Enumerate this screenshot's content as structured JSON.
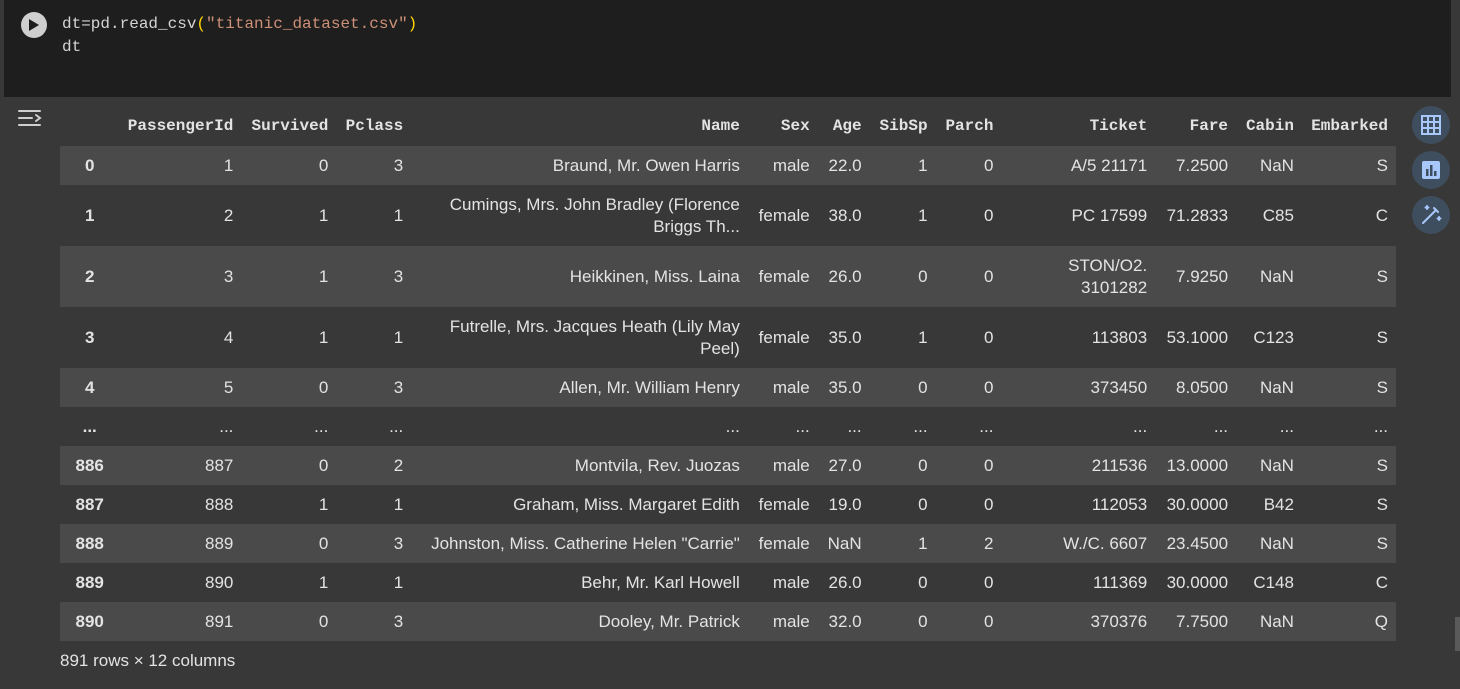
{
  "code_cell": {
    "line1_prefix": "dt=pd.read_csv",
    "line1_open": "(",
    "line1_string": "\"titanic_dataset.csv\"",
    "line1_close": ")",
    "line2": "dt",
    "run_icon": "play-icon"
  },
  "output": {
    "toggle_icon": "output-options-icon",
    "columns": [
      "PassengerId",
      "Survived",
      "Pclass",
      "Name",
      "Sex",
      "Age",
      "SibSp",
      "Parch",
      "Ticket",
      "Fare",
      "Cabin",
      "Embarked"
    ],
    "rows": [
      {
        "index": "0",
        "cells": [
          "1",
          "0",
          "3",
          "Braund, Mr. Owen Harris",
          "male",
          "22.0",
          "1",
          "0",
          "A/5 21171",
          "7.2500",
          "NaN",
          "S"
        ]
      },
      {
        "index": "1",
        "cells": [
          "2",
          "1",
          "1",
          "Cumings, Mrs. John Bradley (Florence Briggs Th...",
          "female",
          "38.0",
          "1",
          "0",
          "PC 17599",
          "71.2833",
          "C85",
          "C"
        ]
      },
      {
        "index": "2",
        "cells": [
          "3",
          "1",
          "3",
          "Heikkinen, Miss. Laina",
          "female",
          "26.0",
          "0",
          "0",
          "STON/O2. 3101282",
          "7.9250",
          "NaN",
          "S"
        ]
      },
      {
        "index": "3",
        "cells": [
          "4",
          "1",
          "1",
          "Futrelle, Mrs. Jacques Heath (Lily May Peel)",
          "female",
          "35.0",
          "1",
          "0",
          "113803",
          "53.1000",
          "C123",
          "S"
        ]
      },
      {
        "index": "4",
        "cells": [
          "5",
          "0",
          "3",
          "Allen, Mr. William Henry",
          "male",
          "35.0",
          "0",
          "0",
          "373450",
          "8.0500",
          "NaN",
          "S"
        ]
      },
      {
        "index": "...",
        "cells": [
          "...",
          "...",
          "...",
          "...",
          "...",
          "...",
          "...",
          "...",
          "...",
          "...",
          "...",
          "..."
        ]
      },
      {
        "index": "886",
        "cells": [
          "887",
          "0",
          "2",
          "Montvila, Rev. Juozas",
          "male",
          "27.0",
          "0",
          "0",
          "211536",
          "13.0000",
          "NaN",
          "S"
        ]
      },
      {
        "index": "887",
        "cells": [
          "888",
          "1",
          "1",
          "Graham, Miss. Margaret Edith",
          "female",
          "19.0",
          "0",
          "0",
          "112053",
          "30.0000",
          "B42",
          "S"
        ]
      },
      {
        "index": "888",
        "cells": [
          "889",
          "0",
          "3",
          "Johnston, Miss. Catherine Helen \"Carrie\"",
          "female",
          "NaN",
          "1",
          "2",
          "W./C. 6607",
          "23.4500",
          "NaN",
          "S"
        ]
      },
      {
        "index": "889",
        "cells": [
          "890",
          "1",
          "1",
          "Behr, Mr. Karl Howell",
          "male",
          "26.0",
          "0",
          "0",
          "111369",
          "30.0000",
          "C148",
          "C"
        ]
      },
      {
        "index": "890",
        "cells": [
          "891",
          "0",
          "3",
          "Dooley, Mr. Patrick",
          "male",
          "32.0",
          "0",
          "0",
          "370376",
          "7.7500",
          "NaN",
          "Q"
        ]
      }
    ],
    "footer": "891 rows × 12 columns"
  },
  "side_actions": [
    {
      "icon": "table-icon"
    },
    {
      "icon": "bar-chart-icon"
    },
    {
      "icon": "magic-wand-icon"
    }
  ],
  "colors": {
    "background": "#383838",
    "code_background": "#1e1e1e",
    "row_alt": "#4a4a4a",
    "string": "#ce9178",
    "paren": "#ffd700",
    "side_button": "#3f4e5e",
    "icon_blue": "#a8c7fa"
  }
}
